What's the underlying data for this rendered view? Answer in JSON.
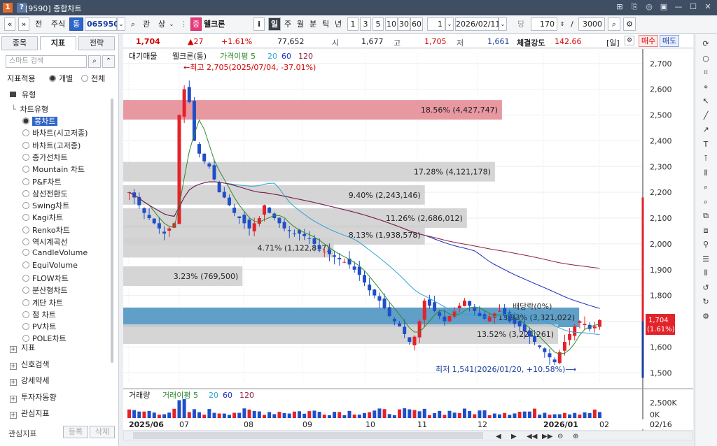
{
  "window": {
    "code": "[9590]",
    "title": "종합차트"
  },
  "toolbar": {
    "prev": "«",
    "next": "»",
    "jeon": "전",
    "market": "주식",
    "tong": "통",
    "code": "065950",
    "gwan": "관",
    "sang": "상",
    "jeung": "증",
    "stock_name": "웰크론",
    "info": "i",
    "il": "일",
    "ju": "주",
    "wol": "월",
    "bun": "분",
    "tick": "틱",
    "nyeon": "년",
    "periods": [
      "1",
      "3",
      "5",
      "10",
      "30",
      "60"
    ],
    "count": "1",
    "date": "2026/02/11",
    "dang": "당",
    "bars": "170",
    "slash": "/",
    "total": "3000"
  },
  "infobar": {
    "price": "1,704",
    "change": "▲27",
    "rate": "+1.61%",
    "volume": "77,652",
    "open_label": "시",
    "open": "1,677",
    "high_label": "고",
    "high": "1,705",
    "low_label": "저",
    "low": "1,661",
    "strength_label": "체결강도",
    "strength": "142.66",
    "period": "[일]",
    "buy": "매수",
    "sell": "매도"
  },
  "left_panel": {
    "tabs": [
      "종목",
      "지표",
      "전략"
    ],
    "search_placeholder": "스마트 검색",
    "apply_label": "지표적용",
    "individual": "개별",
    "all": "전체",
    "group": "유형",
    "subgroup": "차트유형",
    "chart_types": [
      "봉차트",
      "바차트(시고저종)",
      "바차트(고저종)",
      "종가선차트",
      "Mountain 차트",
      "P&F차트",
      "삼선전환도",
      "Swing차트",
      "Kagi차트",
      "Renko차트",
      "역시계곡선",
      "CandleVolume",
      "EquiVolume",
      "FLOW차트",
      "분산형차트",
      "계단 차트",
      "점 차트",
      "PV차트",
      "POLE차트"
    ],
    "sections": [
      "지표",
      "신호검색",
      "강세약세",
      "투자자동향",
      "관심지표"
    ],
    "footer_label": "관심지표",
    "register": "등록",
    "delete": "삭제"
  },
  "chart": {
    "legend_title": "대기매물",
    "legend_series": "웰크론(통)",
    "legend_ma_label": "가격이평 5",
    "legend_ma": [
      "20",
      "60",
      "120"
    ],
    "high_note": "←최고 2,705(2025/07/04, -37.01%)",
    "low_note": "최저 1,541(2026/01/20, +10.58%)⟶",
    "dividend_note": "배당락(0%)",
    "price_tag": "1,704",
    "price_tag_rate": "(1.61%)",
    "y_ticks": [
      "2,700",
      "2,600",
      "2,500",
      "2,400",
      "2,300",
      "2,200",
      "2,100",
      "2,000",
      "1,900",
      "1,800",
      "1,700",
      "1,600",
      "1,500"
    ],
    "x_labels": [
      "2025/06",
      "07",
      "08",
      "09",
      "10",
      "11",
      "12",
      "2026/01",
      "02",
      "02/16"
    ],
    "supply_bars": [
      {
        "label": "18.56% (4,427,747)",
        "color": "#e48d97"
      },
      {
        "label": "17.28% (4,121,178)",
        "color": "#d0d0d0"
      },
      {
        "label": "9.40% (2,243,146)",
        "color": "#d0d0d0"
      },
      {
        "label": "11.26% (2,686,012)",
        "color": "#d0d0d0"
      },
      {
        "label": "8.13% (1,938,578)",
        "color": "#d0d0d0"
      },
      {
        "label": "4.71% (1,122,817)",
        "color": "#d0d0d0"
      },
      {
        "label": "3.23% (769,500)",
        "color": "#d0d0d0"
      },
      {
        "label": "13.93% (3,321,022)",
        "color": "#4f95c2"
      },
      {
        "label": "13.52% (3,224,261)",
        "color": "#d0d0d0"
      }
    ],
    "volume_legend_title": "거래량",
    "volume_legend_ma_label": "거래이평 5",
    "volume_legend_ma": [
      "20",
      "60",
      "120"
    ],
    "volume_ticks": [
      "2,500K",
      "0K"
    ]
  },
  "chart_data": {
    "type": "candlestick",
    "series": [
      {
        "name": "웰크론(통)",
        "points_close": [
          2200,
          2180,
          2150,
          2120,
          2100,
          2080,
          2060,
          2040,
          2060,
          2080,
          2500,
          2600,
          2550,
          2400,
          2350,
          2320,
          2300,
          2250,
          2200,
          2180,
          2150,
          2120,
          2100,
          2080,
          2060,
          2080,
          2100,
          2150,
          2120,
          2100,
          2080,
          2060,
          2050,
          2040,
          2040,
          2030,
          2020,
          2000,
          1980,
          1970,
          1960,
          1950,
          1940,
          1930,
          1920,
          1900,
          1880,
          1850,
          1820,
          1800,
          1780,
          1750,
          1720,
          1700,
          1680,
          1650,
          1620,
          1640,
          1700,
          1780,
          1760,
          1740,
          1720,
          1700,
          1720,
          1740,
          1760,
          1780,
          1760,
          1740,
          1720,
          1710,
          1720,
          1730,
          1740,
          1720,
          1700,
          1690,
          1680,
          1660,
          1640,
          1620,
          1600,
          1580,
          1560,
          1541,
          1580,
          1620,
          1650,
          1680,
          1700,
          1690,
          1670,
          1680,
          1704
        ]
      }
    ],
    "moving_average_labels": [
      "5",
      "20",
      "60",
      "120"
    ],
    "y_range": [
      1460,
      2740
    ],
    "high": {
      "value": 2705,
      "date": "2025/07/04"
    },
    "low": {
      "value": 1541,
      "date": "2026/01/20"
    },
    "last": 1704
  },
  "right_bar": {
    "icons": [
      "rotate-icon",
      "circle-icon",
      "bar-icon",
      "crosshair-icon",
      "cursor-icon",
      "line-icon",
      "trend-icon",
      "text-icon",
      "fib-icon",
      "candle-icon",
      "zoom-icon",
      "magnify-icon",
      "copy-icon",
      "chart-icon",
      "filter-icon",
      "lines-icon",
      "bars-icon",
      "refresh-icon",
      "reload-icon",
      "settings-icon"
    ]
  },
  "bottom_bar": {
    "controls": [
      "◀",
      "▶",
      "◀◀",
      "▶▶",
      "⊖",
      "⊕"
    ]
  }
}
